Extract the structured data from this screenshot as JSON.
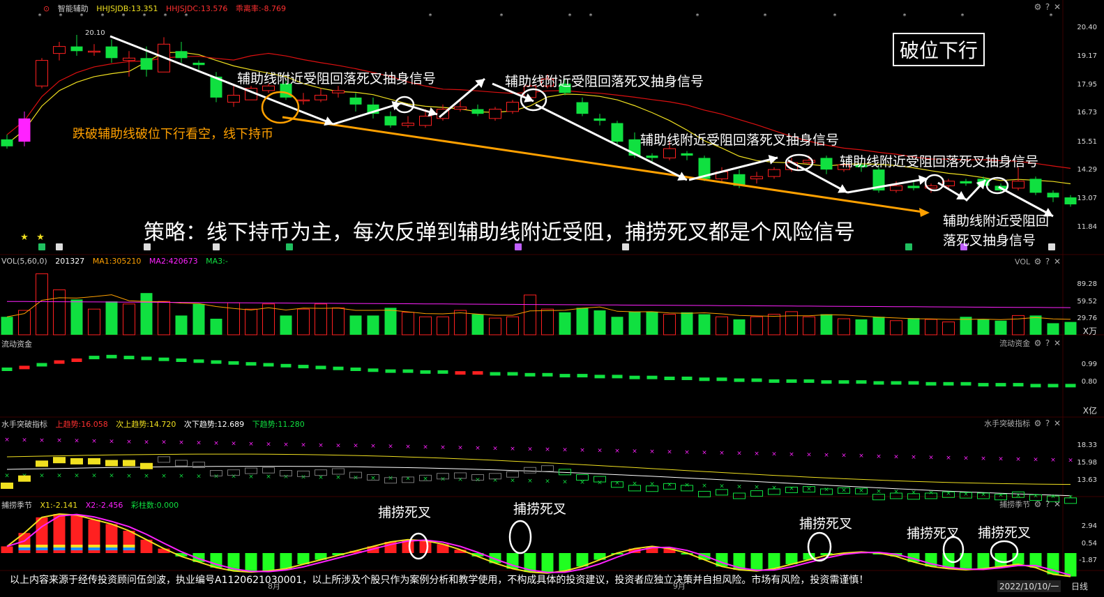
{
  "colors": {
    "up": "#ff2020",
    "down": "#10e040",
    "yellow": "#f0e020",
    "white": "#ffffff",
    "magenta": "#ff22ff",
    "orange": "#ffa000"
  },
  "top_bar": {
    "title": "智能辅助",
    "hhjsjdb": "HHJSJDB:13.351",
    "hhjsjdc": "HHJSJDC:13.576",
    "deviation": "乖离率:-8.769",
    "icons": [
      "gear-icon",
      "help-icon",
      "close-icon"
    ]
  },
  "main_panel": {
    "price_axis": [
      "20.40",
      "19.17",
      "17.95",
      "16.73",
      "15.51",
      "14.29",
      "13.07",
      "11.84"
    ],
    "high_label": "20.10",
    "title_box": "破位下行",
    "signal_labels": [
      "辅助线附近受阻回落死叉抽身信号",
      "辅助线附近受阻回落死叉抽身信号",
      "辅助线附近受阻回落死叉抽身信号",
      "辅助线附近受阻回落死叉抽身信号"
    ],
    "last_signal_line1": "辅助线附近受阻回",
    "last_signal_line2": "落死叉抽身信号",
    "breakdown_note": "跌破辅助线破位下行看空，线下持币",
    "strategy": "策略：线下持币为主，每次反弹到辅助线附近受阻，捕捞死叉都是个风险信号"
  },
  "vol_panel": {
    "label": "VOL(5,60,0)",
    "value": "201327",
    "ma1": "MA1:305210",
    "ma2": "MA2:420673",
    "ma3": "MA3:-",
    "right_label": "VOL",
    "axis": [
      "89.28",
      "59.52",
      "29.76"
    ],
    "unit": "X万"
  },
  "fund_panel": {
    "label": "流动资金",
    "right_label": "流动资金",
    "axis": [
      "0.99",
      "0.80"
    ],
    "unit": "X亿"
  },
  "sailor_panel": {
    "label": "水手突破指标",
    "up_trend": "上趋势:16.058",
    "sub_up": "次上趋势:14.720",
    "sub_down": "次下趋势:12.689",
    "down_trend": "下趋势:11.280",
    "right_label": "水手突破指标",
    "axis": [
      "18.33",
      "15.98",
      "13.63"
    ]
  },
  "catch_panel": {
    "label": "捕捞季节",
    "x1": "X1:-2.141",
    "x2": "X2:-2.456",
    "bars": "彩柱数:0.000",
    "right_label": "捕捞季节",
    "axis": [
      "2.94",
      "0.54",
      "-1.87"
    ],
    "dead_cross_labels": [
      "捕捞死叉",
      "捕捞死叉",
      "捕捞死叉",
      "捕捞死叉",
      "捕捞死叉"
    ]
  },
  "disclaimer": "以上内容来源于经传投资顾问伍剑波，执业编号A1120621030001，以上所涉及个股只作为案例分析和教学使用，不构成具体的投资建议，投资者应独立决策并自担风险。市场有风险，投资需谨慎！",
  "status_bar": {
    "date": "2022/10/10/一",
    "period": "日线",
    "month_aug": "8月",
    "month_sep": "9月"
  },
  "chart_data": {
    "type": "candlestick",
    "title": "破位下行",
    "y_axis_ticks": [
      20.4,
      19.17,
      17.95,
      16.73,
      15.51,
      14.29,
      13.07,
      11.84
    ],
    "candles": [
      [
        15.6,
        15.3,
        15.8,
        15.2
      ],
      [
        15.5,
        16.5,
        16.8,
        15.3
      ],
      [
        17.9,
        19.0,
        19.1,
        17.8
      ],
      [
        19.3,
        19.6,
        19.8,
        19.0
      ],
      [
        19.6,
        19.4,
        20.1,
        19.2
      ],
      [
        19.4,
        19.4,
        19.7,
        19.2
      ],
      [
        19.6,
        19.1,
        19.9,
        18.9
      ],
      [
        19.0,
        19.1,
        19.4,
        18.3
      ],
      [
        19.1,
        18.6,
        19.6,
        18.3
      ],
      [
        18.5,
        19.7,
        20.0,
        18.5
      ],
      [
        19.4,
        19.1,
        19.8,
        18.9
      ],
      [
        18.9,
        18.8,
        19.0,
        18.6
      ],
      [
        18.3,
        17.4,
        18.5,
        17.2
      ],
      [
        17.2,
        17.5,
        17.9,
        17.0
      ],
      [
        17.3,
        17.8,
        17.9,
        17.3
      ],
      [
        17.7,
        17.9,
        18.0,
        17.6
      ],
      [
        18.0,
        17.4,
        18.2,
        17.3
      ],
      [
        17.3,
        17.3,
        17.6,
        17.1
      ],
      [
        17.3,
        17.5,
        17.8,
        17.2
      ],
      [
        17.6,
        17.7,
        17.9,
        17.4
      ],
      [
        17.4,
        17.1,
        17.6,
        16.8
      ],
      [
        17.1,
        16.7,
        17.4,
        16.5
      ],
      [
        16.6,
        16.2,
        16.8,
        16.1
      ],
      [
        16.2,
        16.3,
        16.6,
        16.1
      ],
      [
        16.2,
        16.6,
        16.9,
        16.1
      ],
      [
        16.5,
        16.9,
        17.1,
        16.4
      ],
      [
        16.9,
        17.0,
        17.3,
        16.8
      ],
      [
        16.9,
        16.7,
        17.1,
        16.6
      ],
      [
        16.5,
        16.9,
        17.0,
        16.4
      ],
      [
        16.8,
        17.2,
        17.3,
        16.7
      ],
      [
        17.4,
        17.9,
        18.1,
        17.3
      ],
      [
        17.9,
        18.2,
        18.4,
        17.8
      ],
      [
        18.0,
        17.6,
        18.2,
        17.5
      ],
      [
        17.2,
        16.7,
        17.4,
        16.6
      ],
      [
        16.5,
        16.4,
        16.7,
        16.2
      ],
      [
        16.3,
        15.5,
        16.4,
        15.4
      ],
      [
        15.6,
        14.9,
        15.9,
        14.8
      ],
      [
        14.9,
        14.8,
        15.0,
        14.6
      ],
      [
        14.8,
        15.2,
        15.5,
        14.7
      ],
      [
        15.0,
        14.9,
        15.1,
        14.7
      ],
      [
        14.8,
        13.9,
        14.9,
        13.8
      ],
      [
        13.9,
        14.2,
        14.4,
        13.8
      ],
      [
        14.1,
        13.6,
        14.3,
        13.5
      ],
      [
        13.9,
        14.0,
        14.2,
        13.7
      ],
      [
        14.0,
        14.3,
        14.4,
        13.9
      ],
      [
        14.3,
        14.6,
        14.8,
        14.2
      ],
      [
        14.6,
        14.7,
        14.9,
        14.5
      ],
      [
        14.8,
        14.3,
        14.9,
        14.1
      ],
      [
        14.3,
        14.5,
        14.6,
        14.2
      ],
      [
        14.5,
        14.4,
        14.6,
        14.2
      ],
      [
        14.3,
        13.4,
        14.4,
        13.3
      ],
      [
        13.4,
        13.6,
        13.8,
        13.3
      ],
      [
        13.6,
        13.5,
        13.8,
        13.4
      ],
      [
        13.5,
        13.6,
        13.7,
        13.3
      ],
      [
        13.6,
        13.8,
        13.9,
        13.5
      ],
      [
        13.8,
        13.7,
        13.9,
        13.6
      ],
      [
        13.9,
        13.6,
        14.0,
        13.5
      ],
      [
        13.6,
        13.4,
        13.7,
        13.3
      ],
      [
        13.5,
        13.8,
        14.4,
        13.4
      ],
      [
        13.9,
        13.3,
        14.0,
        13.2
      ],
      [
        13.3,
        13.1,
        13.4,
        12.9
      ],
      [
        13.1,
        12.8,
        13.2,
        12.7
      ]
    ],
    "volume": [
      28,
      38,
      95,
      70,
      55,
      40,
      52,
      48,
      65,
      52,
      30,
      48,
      25,
      50,
      40,
      48,
      30,
      40,
      48,
      42,
      30,
      30,
      42,
      35,
      28,
      28,
      38,
      32,
      26,
      28,
      62,
      40,
      35,
      42,
      38,
      28,
      36,
      36,
      32,
      35,
      32,
      28,
      24,
      28,
      32,
      36,
      28,
      32,
      25,
      24,
      28,
      22,
      26,
      24,
      20,
      28,
      24,
      22,
      30,
      30,
      18,
      20
    ],
    "fund_flow": [
      0.9,
      0.92,
      0.95,
      0.98,
      1.0,
      1.03,
      1.04,
      1.03,
      1.02,
      1.01,
      1.0,
      0.99,
      0.98,
      0.97,
      0.96,
      0.95,
      0.94,
      0.93,
      0.92,
      0.91,
      0.9,
      0.89,
      0.88,
      0.88,
      0.87,
      0.87,
      0.86,
      0.86,
      0.85,
      0.85,
      0.84,
      0.84,
      0.83,
      0.83,
      0.82,
      0.82,
      0.81,
      0.81,
      0.8,
      0.8,
      0.79,
      0.79,
      0.78,
      0.78,
      0.77,
      0.77,
      0.77,
      0.76,
      0.76,
      0.76,
      0.75,
      0.75,
      0.75,
      0.74,
      0.74,
      0.74,
      0.73,
      0.73,
      0.73,
      0.72,
      0.72,
      0.72
    ],
    "catch_x1": [
      0.6,
      1.8,
      3.2,
      3.5,
      3.4,
      3.0,
      2.6,
      2.0,
      1.2,
      0.4,
      -0.3,
      -0.8,
      -1.3,
      -1.6,
      -1.7,
      -1.6,
      -1.4,
      -1.0,
      -0.6,
      -0.2,
      0.2,
      0.6,
      1.0,
      1.2,
      1.1,
      0.8,
      0.3,
      -0.3,
      -0.9,
      -1.4,
      -1.7,
      -1.8,
      -1.6,
      -1.2,
      -0.6,
      0.0,
      0.4,
      0.6,
      0.4,
      0.0,
      -0.6,
      -1.2,
      -1.5,
      -1.6,
      -1.4,
      -1.0,
      -0.6,
      -0.2,
      0.0,
      0.1,
      0.0,
      -0.3,
      -0.8,
      -1.2,
      -1.4,
      -1.5,
      -1.4,
      -1.2,
      -1.0,
      -1.3,
      -1.9,
      -2.1
    ]
  }
}
